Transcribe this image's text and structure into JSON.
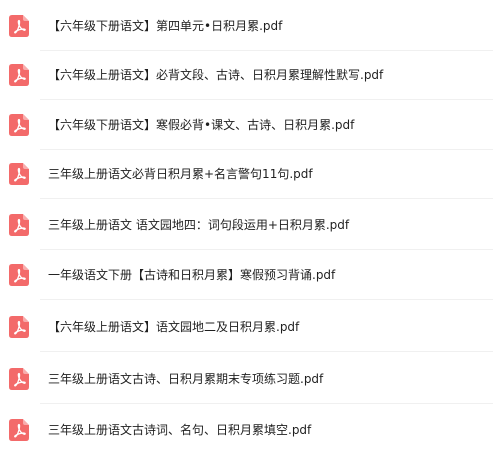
{
  "icon": "pdf-file-icon",
  "accent_color": "#f36a6a",
  "files": [
    {
      "name": "【六年级下册语文】第四单元•日积月累.pdf"
    },
    {
      "name": "【六年级上册语文】必背文段、古诗、日积月累理解性默写.pdf"
    },
    {
      "name": "【六年级下册语文】寒假必背•课文、古诗、日积月累.pdf"
    },
    {
      "name": "三年级上册语文必背日积月累+名言警句11句.pdf"
    },
    {
      "name": "三年级上册语文 语文园地四：词句段运用+日积月累.pdf"
    },
    {
      "name": "一年级语文下册【古诗和日积月累】寒假预习背诵.pdf"
    },
    {
      "name": "【六年级上册语文】语文园地二及日积月累.pdf"
    },
    {
      "name": "三年级上册语文古诗、日积月累期末专项练习题.pdf"
    },
    {
      "name": "三年级上册语文古诗词、名句、日积月累填空.pdf"
    }
  ]
}
